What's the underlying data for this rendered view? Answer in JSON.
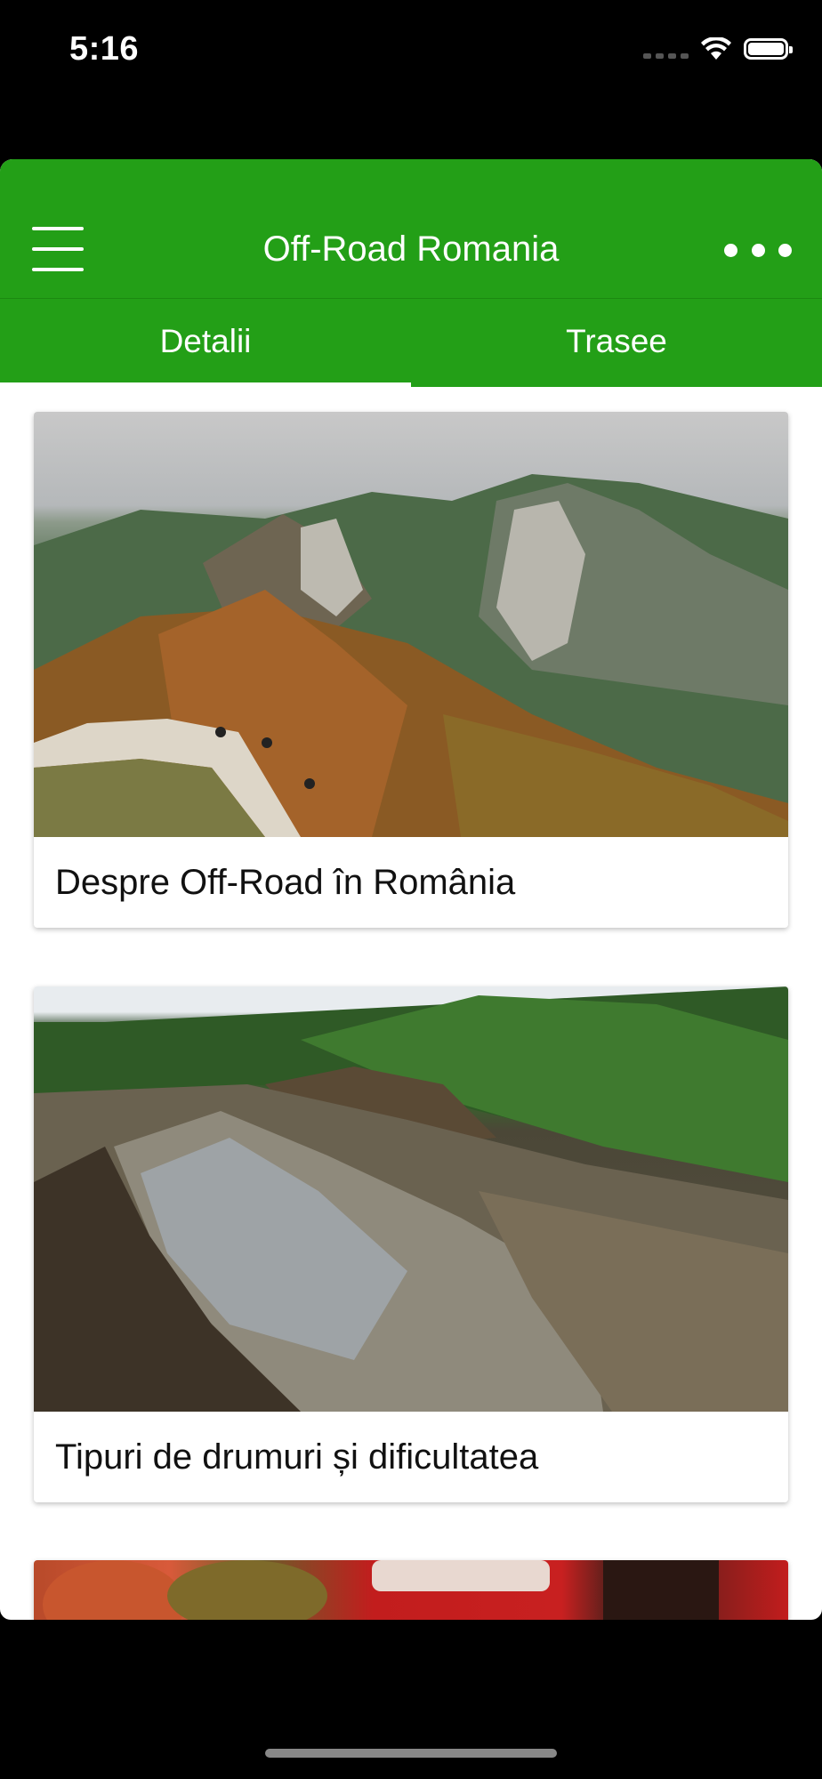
{
  "status_bar": {
    "time": "5:16",
    "icons": [
      "signal-icon",
      "wifi-icon",
      "battery-icon"
    ]
  },
  "header": {
    "title": "Off-Road Romania",
    "menu_icon": "hamburger-menu-icon",
    "more_icon": "more-options-icon",
    "color": "#239f17"
  },
  "tabs": [
    {
      "label": "Detalii",
      "active": true
    },
    {
      "label": "Trasee",
      "active": false
    }
  ],
  "cards": [
    {
      "title": "Despre Off-Road în România",
      "image": "mountain-road-photo"
    },
    {
      "title": "Tipuri de drumuri și dificultatea",
      "image": "muddy-forest-road-photo"
    },
    {
      "title": "",
      "image": "food-photo"
    }
  ]
}
